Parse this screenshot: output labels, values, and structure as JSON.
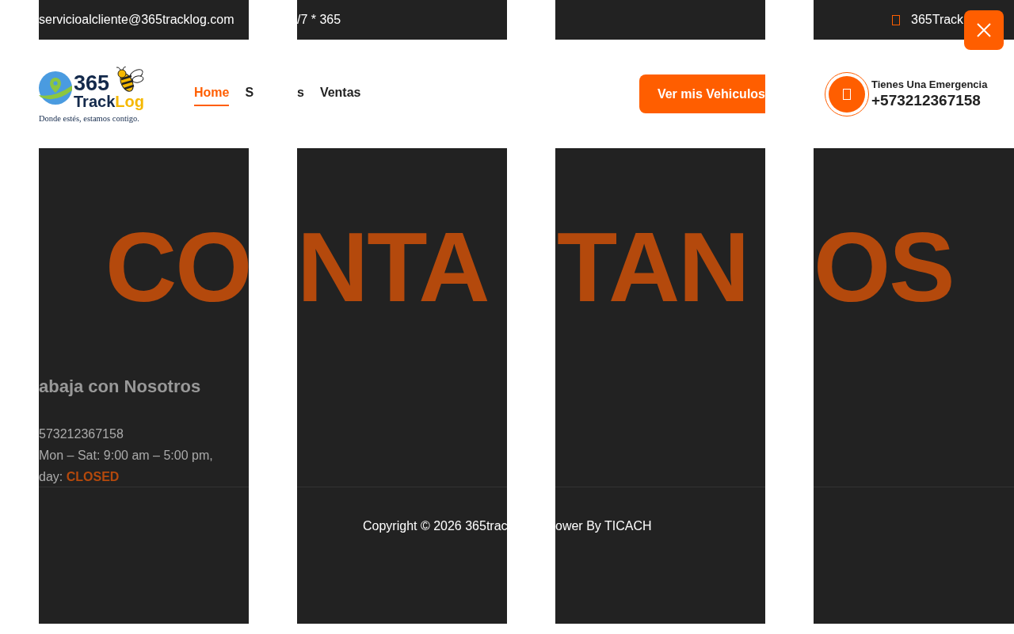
{
  "top_bar": {
    "email": "servicioalcliente@365tracklog.com",
    "hours": "/7 * 365",
    "brand": "365Track"
  },
  "logo": {
    "number": "365",
    "word": "Track",
    "accent": "Log",
    "tagline": "Donde estés, estamos contigo."
  },
  "nav": [
    {
      "items": [
        {
          "label": "Home",
          "selected": true
        },
        {
          "label": "S",
          "selected": false
        }
      ]
    },
    {
      "items": [
        {
          "label": "s",
          "selected": false
        },
        {
          "label": "Ventas",
          "selected": false
        }
      ]
    }
  ],
  "cta_button": "Ver mis Vehiculos",
  "emergency": {
    "label": "Tienes Una Emergencia",
    "phone": "+573212367158"
  },
  "title_fragments": [
    "CO",
    "NTA",
    "TAN",
    "OS"
  ],
  "contact": {
    "heading": "abaja con Nosotros",
    "phone": "573212367158",
    "hours": "Mon – Sat: 9:00 am – 5:00 pm,",
    "closed_label": "day:",
    "closed_value": "CLOSED"
  },
  "copyright_fragments": [
    "Copyright © 2026 365trac",
    "ower By TICACH"
  ]
}
